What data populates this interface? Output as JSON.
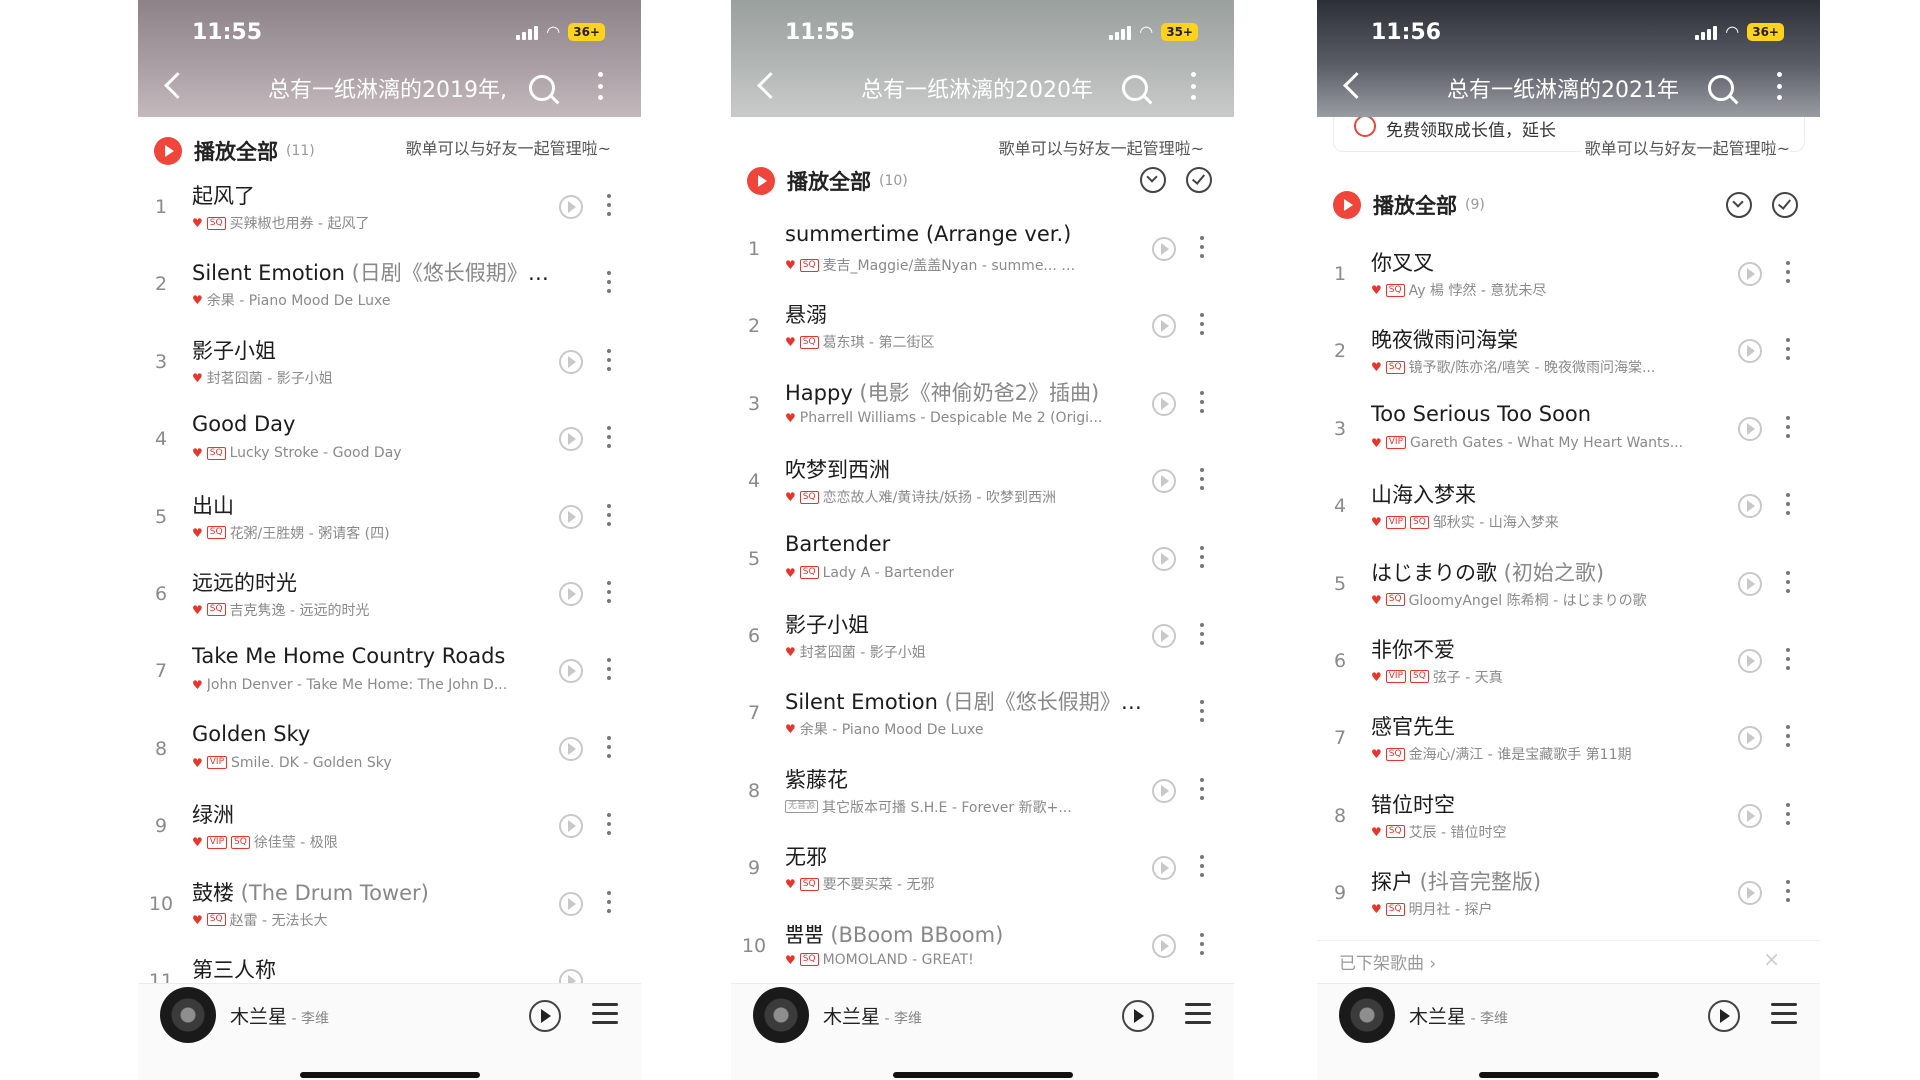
{
  "panels": [
    {
      "status": {
        "time": "11:55",
        "battery": "36+"
      },
      "title": "总有一纸淋漓的2019年,",
      "tip": "歌单可以与好友一起管理啦~",
      "play_all": {
        "label": "播放全部",
        "count": "(11)"
      },
      "songs": [
        {
          "num": "1",
          "title": "起风了",
          "extra": "",
          "tags": [
            "SQ"
          ],
          "sub": "买辣椒也用券 - 起风了"
        },
        {
          "num": "2",
          "title": "Silent Emotion",
          "extra": " (日剧《悠长假期》主…",
          "tags": [],
          "sub": "余果 - Piano Mood De Luxe"
        },
        {
          "num": "3",
          "title": "影子小姐",
          "extra": "",
          "tags": [],
          "sub": "封茗囧菌 - 影子小姐"
        },
        {
          "num": "4",
          "title": "Good Day",
          "extra": "",
          "tags": [
            "SQ"
          ],
          "sub": "Lucky Stroke - Good Day"
        },
        {
          "num": "5",
          "title": "出山",
          "extra": "",
          "tags": [
            "SQ"
          ],
          "sub": "花粥/王胜娚 - 粥请客 (四)"
        },
        {
          "num": "6",
          "title": "远远的时光",
          "extra": "",
          "tags": [
            "SQ"
          ],
          "sub": "吉克隽逸 - 远远的时光"
        },
        {
          "num": "7",
          "title": "Take Me Home Country Roads",
          "extra": "",
          "tags": [],
          "sub": "John Denver - Take Me Home: The John D..."
        },
        {
          "num": "8",
          "title": "Golden Sky",
          "extra": "",
          "tags": [
            "VIP"
          ],
          "sub": "Smile. DK - Golden Sky"
        },
        {
          "num": "9",
          "title": "绿洲",
          "extra": "",
          "tags": [
            "VIP",
            "SQ"
          ],
          "sub": "徐佳莹 - 极限"
        },
        {
          "num": "10",
          "title": "鼓楼",
          "extra": " (The Drum Tower)",
          "tags": [
            "SQ"
          ],
          "sub": "赵雷 - 无法长大"
        },
        {
          "num": "11",
          "title": "第三人称",
          "extra": "",
          "tags": [],
          "sub": ""
        }
      ],
      "player": {
        "title": "木兰星",
        "artist": " - 李维"
      }
    },
    {
      "status": {
        "time": "11:55",
        "battery": "35+"
      },
      "title": "总有一纸淋漓的2020年",
      "tip": "歌单可以与好友一起管理啦~",
      "play_all": {
        "label": "播放全部",
        "count": "(10)"
      },
      "songs": [
        {
          "num": "1",
          "title": "summertime (Arrange ver.)",
          "extra": "",
          "tags": [
            "SQ"
          ],
          "sub": "麦吉_Maggie/盖盖Nyan - summe... …"
        },
        {
          "num": "2",
          "title": "悬溺",
          "extra": "",
          "tags": [
            "SQ"
          ],
          "sub": "葛东琪 - 第二街区"
        },
        {
          "num": "3",
          "title": "Happy",
          "extra": " (电影《神偷奶爸2》插曲)",
          "tags": [],
          "sub": "Pharrell Williams - Despicable Me 2 (Origi..."
        },
        {
          "num": "4",
          "title": "吹梦到西洲",
          "extra": "",
          "tags": [
            "SQ"
          ],
          "sub": "恋恋故人难/黄诗扶/妖扬 - 吹梦到西洲"
        },
        {
          "num": "5",
          "title": "Bartender",
          "extra": "",
          "tags": [
            "SQ"
          ],
          "sub": "Lady A - Bartender"
        },
        {
          "num": "6",
          "title": "影子小姐",
          "extra": "",
          "tags": [],
          "sub": "封茗囧菌 - 影子小姐"
        },
        {
          "num": "7",
          "title": "Silent Emotion",
          "extra": " (日剧《悠长假期》主…",
          "tags": [],
          "sub": "余果 - Piano Mood De Luxe"
        },
        {
          "num": "8",
          "title": "紫藤花",
          "extra": "",
          "tags": [
            "无音源"
          ],
          "sub": "其它版本可播  S.H.E - Forever 新歌+..."
        },
        {
          "num": "9",
          "title": "无邪",
          "extra": "",
          "tags": [
            "SQ"
          ],
          "sub": "要不要买菜 - 无邪"
        },
        {
          "num": "10",
          "title": "뿜뿜",
          "extra": " (BBoom BBoom)",
          "tags": [
            "SQ"
          ],
          "sub": "MOMOLAND - GREAT!"
        }
      ],
      "player": {
        "title": "木兰星",
        "artist": " - 李维"
      }
    },
    {
      "status": {
        "time": "11:56",
        "battery": "36+"
      },
      "title": "总有一纸淋漓的2021年",
      "promo": "免费领取成长值，延长",
      "tip": "歌单可以与好友一起管理啦~",
      "play_all": {
        "label": "播放全部",
        "count": "(9)"
      },
      "songs": [
        {
          "num": "1",
          "title": "你叉叉",
          "extra": "",
          "tags": [
            "SQ"
          ],
          "sub": "Ay 楊 悖然 - 意犹未尽"
        },
        {
          "num": "2",
          "title": "晚夜微雨问海棠",
          "extra": "",
          "tags": [
            "SQ"
          ],
          "sub": "镜予歌/陈亦洺/嘻笑 - 晚夜微雨问海棠..."
        },
        {
          "num": "3",
          "title": "Too Serious Too Soon",
          "extra": "",
          "tags": [
            "VIP"
          ],
          "sub": "Gareth Gates - What My Heart Wants..."
        },
        {
          "num": "4",
          "title": "山海入梦来",
          "extra": "",
          "tags": [
            "VIP",
            "SQ"
          ],
          "sub": "邹秋实 - 山海入梦来"
        },
        {
          "num": "5",
          "title": "はじまりの歌",
          "extra": " (初始之歌)",
          "tags": [
            "SQ"
          ],
          "sub": "GloomyAngel 陈希桐 - はじまりの歌"
        },
        {
          "num": "6",
          "title": "非你不爱",
          "extra": "",
          "tags": [
            "VIP",
            "SQ"
          ],
          "sub": "弦子 - 天真"
        },
        {
          "num": "7",
          "title": "感官先生",
          "extra": "",
          "tags": [
            "SQ"
          ],
          "sub": "金海心/满江 - 谁是宝藏歌手 第11期"
        },
        {
          "num": "8",
          "title": "错位时空",
          "extra": "",
          "tags": [
            "SQ"
          ],
          "sub": "艾辰 - 错位时空"
        },
        {
          "num": "9",
          "title": "探户",
          "extra": " (抖音完整版)",
          "tags": [
            "SQ"
          ],
          "sub": "明月社 - 探户"
        }
      ],
      "removed_label": "已下架歌曲 ›",
      "player": {
        "title": "木兰星",
        "artist": " - 李维"
      }
    }
  ]
}
